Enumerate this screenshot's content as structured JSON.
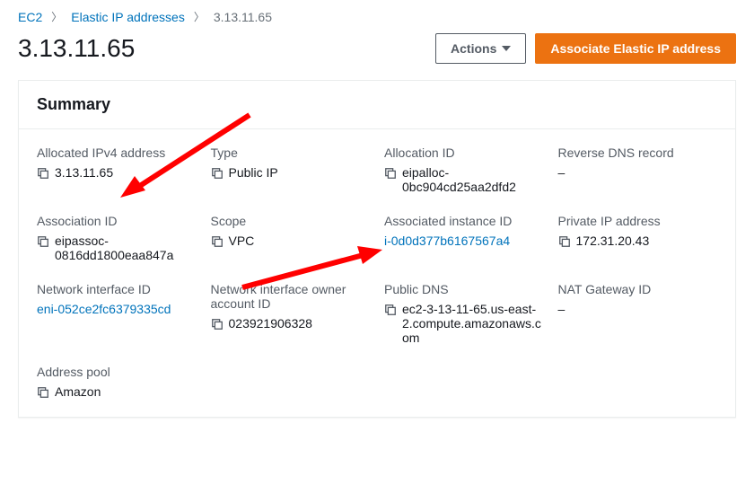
{
  "breadcrumb": {
    "root": "EC2",
    "section": "Elastic IP addresses",
    "current": "3.13.11.65"
  },
  "page_title": "3.13.11.65",
  "actions": {
    "actions_label": "Actions",
    "associate_label": "Associate Elastic IP address"
  },
  "summary": {
    "heading": "Summary",
    "fields": {
      "allocated_ipv4": {
        "label": "Allocated IPv4 address",
        "value": "3.13.11.65",
        "copy": true
      },
      "type": {
        "label": "Type",
        "value": "Public IP",
        "copy": true
      },
      "allocation_id": {
        "label": "Allocation ID",
        "value": "eipalloc-0bc904cd25aa2dfd2",
        "copy": true
      },
      "reverse_dns": {
        "label": "Reverse DNS record",
        "value": "–"
      },
      "association_id": {
        "label": "Association ID",
        "value": "eipassoc-0816dd1800eaa847a",
        "copy": true
      },
      "scope": {
        "label": "Scope",
        "value": "VPC",
        "copy": true
      },
      "assoc_instance": {
        "label": "Associated instance ID",
        "value": "i-0d0d377b6167567a4",
        "link": true
      },
      "private_ip": {
        "label": "Private IP address",
        "value": "172.31.20.43",
        "copy": true
      },
      "eni": {
        "label": "Network interface ID",
        "value": "eni-052ce2fc6379335cd",
        "link": true
      },
      "eni_owner": {
        "label": "Network interface owner account ID",
        "value": "023921906328",
        "copy": true
      },
      "public_dns": {
        "label": "Public DNS",
        "value": "ec2-3-13-11-65.us-east-2.compute.amazonaws.com",
        "copy": true
      },
      "nat_gw": {
        "label": "NAT Gateway ID",
        "value": "–"
      },
      "address_pool": {
        "label": "Address pool",
        "value": "Amazon",
        "copy": true
      }
    }
  }
}
